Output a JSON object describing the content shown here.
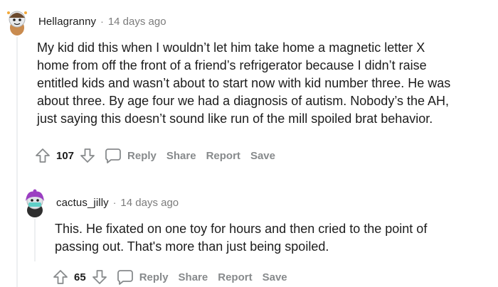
{
  "comments": [
    {
      "username": "Hellagranny",
      "separator": "·",
      "timestamp": "14 days ago",
      "body_lines": [
        "My kid did this when I wouldn’t let him take home a magnetic letter X",
        "home from off the front of a friend’s refrigerator because I didn’t raise",
        "entitled kids and wasn’t about to start now with kid number three. He was",
        "about three. By age four we had a diagnosis of autism. Nobody’s the AH,",
        "just saying this doesn’t sound like run of the mill spoiled brat behavior."
      ],
      "score": "107",
      "actions": {
        "reply": "Reply",
        "share": "Share",
        "report": "Report",
        "save": "Save"
      }
    },
    {
      "username": "cactus_jilly",
      "separator": "·",
      "timestamp": "14 days ago",
      "body_lines": [
        "This. He fixated on one toy for hours and then cried to the point of",
        "passing out. That's more than just being spoiled."
      ],
      "score": "65",
      "actions": {
        "reply": "Reply",
        "share": "Share",
        "report": "Report",
        "save": "Save"
      }
    }
  ],
  "icons": {
    "upvote": "upvote-arrow-icon",
    "downvote": "downvote-arrow-icon",
    "comment": "speech-bubble-icon",
    "avatar1": "snoo-avatar-hellagranny",
    "avatar2": "snoo-avatar-cactus-jilly"
  },
  "colors": {
    "text": "#1c1c1c",
    "meta": "#7c7c7c",
    "action": "#878a8c",
    "thread_line": "#edeff1",
    "avatar2_hair": "#9b3fc2"
  }
}
